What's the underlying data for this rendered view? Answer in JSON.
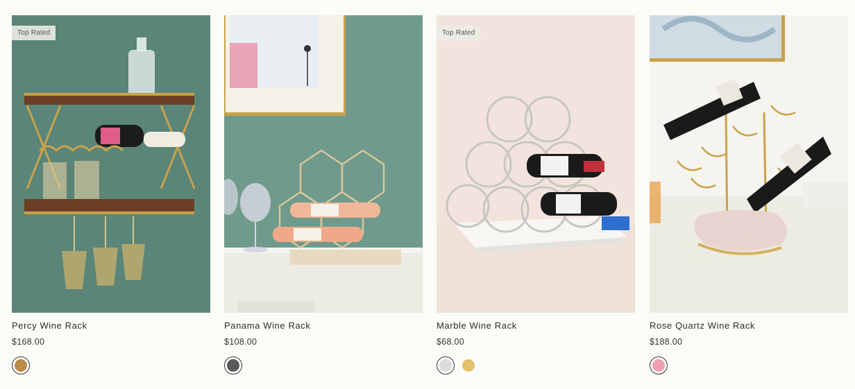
{
  "products": [
    {
      "name": "Percy Wine Rack",
      "price": "$168.00",
      "badge": "Top Rated",
      "swatches": [
        {
          "color": "#b98a4a",
          "selected": true
        }
      ],
      "image_bg": "#5f8b7e"
    },
    {
      "name": "Panama Wine Rack",
      "price": "$108.00",
      "badge": "",
      "swatches": [
        {
          "color": "#5a5a5a",
          "selected": true
        }
      ],
      "image_bg": "#6f9a8c"
    },
    {
      "name": "Marble Wine Rack",
      "price": "$68.00",
      "badge": "Top Rated",
      "swatches": [
        {
          "color": "#dcdcdc",
          "selected": true
        },
        {
          "color": "#e2c26a",
          "selected": false
        }
      ],
      "image_bg": "#f2e4dc"
    },
    {
      "name": "Rose Quartz Wine Rack",
      "price": "$188.00",
      "badge": "",
      "swatches": [
        {
          "color": "#f0a0b2",
          "selected": true
        }
      ],
      "image_bg": "#f5f4ef"
    }
  ]
}
